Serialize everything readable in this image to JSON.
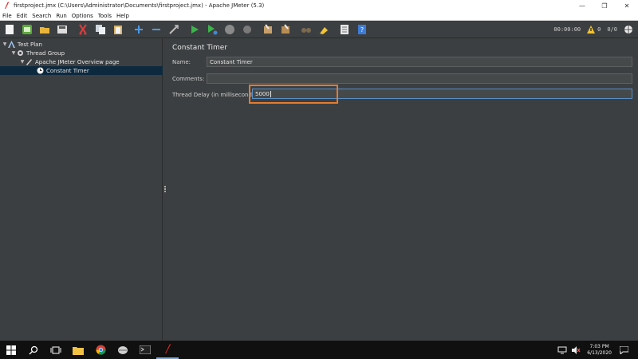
{
  "window": {
    "title": "firstproject.jmx (C:\\Users\\Administrator\\Documents\\firstproject.jmx) - Apache JMeter (5.3)",
    "minimize": "—",
    "maximize": "❐",
    "close": "✕"
  },
  "menu": [
    "File",
    "Edit",
    "Search",
    "Run",
    "Options",
    "Tools",
    "Help"
  ],
  "toolbar": {
    "timer": "00:00:00",
    "warning_count": "0",
    "threads": "0/0"
  },
  "tree": {
    "items": [
      {
        "label": "Test Plan"
      },
      {
        "label": "Thread Group"
      },
      {
        "label": "Apache JMeter Overview page"
      },
      {
        "label": "Constant Timer"
      }
    ]
  },
  "panel": {
    "title": "Constant Timer",
    "name_label": "Name:",
    "name_value": "Constant Timer",
    "comments_label": "Comments:",
    "comments_value": "",
    "delay_label": "Thread Delay (in milliseconds):",
    "delay_value": "5000"
  },
  "taskbar": {
    "time": "7:03 PM",
    "date": "6/13/2020"
  },
  "colors": {
    "background": "#3c3f41",
    "selection": "#0d293e",
    "highlight": "#e47c2f",
    "focus_border": "#5a8ec6"
  }
}
